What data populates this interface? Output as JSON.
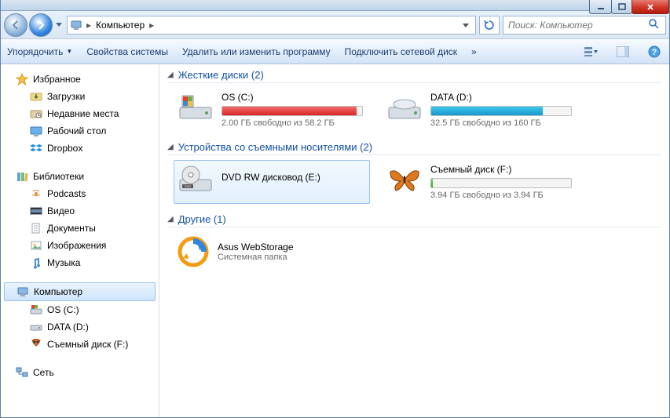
{
  "breadcrumb": {
    "root": "Компьютер"
  },
  "search": {
    "placeholder": "Поиск: Компьютер"
  },
  "toolbar": {
    "organize": "Упорядочить",
    "properties": "Свойства системы",
    "uninstall": "Удалить или изменить программу",
    "map_drive": "Подключить сетевой диск",
    "overflow": "»"
  },
  "sidebar": {
    "favorites": {
      "label": "Избранное",
      "items": [
        {
          "label": "Загрузки",
          "icon": "downloads"
        },
        {
          "label": "Недавние места",
          "icon": "recent"
        },
        {
          "label": "Рабочий стол",
          "icon": "desktop"
        },
        {
          "label": "Dropbox",
          "icon": "dropbox"
        }
      ]
    },
    "libraries": {
      "label": "Библиотеки",
      "items": [
        {
          "label": "Podcasts",
          "icon": "podcasts"
        },
        {
          "label": "Видео",
          "icon": "video"
        },
        {
          "label": "Документы",
          "icon": "documents"
        },
        {
          "label": "Изображения",
          "icon": "images"
        },
        {
          "label": "Музыка",
          "icon": "music"
        }
      ]
    },
    "computer": {
      "label": "Компьютер",
      "items": [
        {
          "label": "OS (C:)",
          "icon": "drive-os"
        },
        {
          "label": "DATA (D:)",
          "icon": "drive"
        },
        {
          "label": "Съемный диск (F:)",
          "icon": "removable"
        }
      ]
    },
    "network": {
      "label": "Сеть"
    }
  },
  "groups": {
    "hdd": {
      "title": "Жесткие диски (2)"
    },
    "removable": {
      "title": "Устройства со съемными носителями (2)"
    },
    "other": {
      "title": "Другие (1)"
    }
  },
  "drives": {
    "c": {
      "name": "OS (C:)",
      "status": "2.00 ГБ свободно из 58.2 ГБ",
      "used_pct": 96,
      "color": "red"
    },
    "d": {
      "name": "DATA (D:)",
      "status": "32.5 ГБ свободно из 160 ГБ",
      "used_pct": 80,
      "color": "blue"
    },
    "e": {
      "name": "DVD RW дисковод (E:)"
    },
    "f": {
      "name": "Съемный диск (F:)",
      "status": "3.94 ГБ свободно из 3.94 ГБ",
      "used_pct": 1,
      "color": "empty"
    }
  },
  "other": {
    "asus": {
      "name": "Asus WebStorage",
      "sub": "Системная папка"
    }
  }
}
